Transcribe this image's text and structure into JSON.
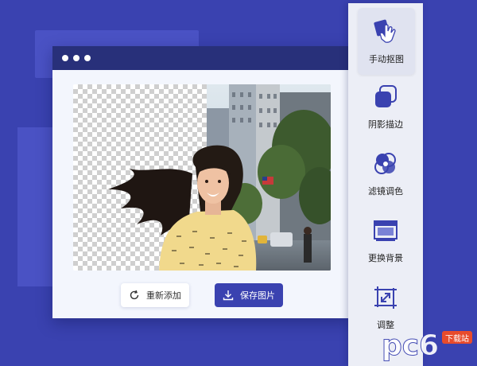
{
  "toolbar": {
    "readd_label": "重新添加",
    "save_label": "保存图片"
  },
  "tools": [
    {
      "label": "手动抠图",
      "icon": "hand-cutout-icon",
      "active": true
    },
    {
      "label": "阴影描边",
      "icon": "shadow-outline-icon",
      "active": false
    },
    {
      "label": "滤镜调色",
      "icon": "filter-color-icon",
      "active": false
    },
    {
      "label": "更换背景",
      "icon": "change-background-icon",
      "active": false
    },
    {
      "label": "调整",
      "icon": "resize-icon",
      "active": false
    }
  ],
  "watermark": {
    "logo": "pc6",
    "tag": "下载站"
  },
  "colors": {
    "background": "#3a42b0",
    "titlebar": "#28307a",
    "accent": "#3a42b0",
    "panel": "#eceef6"
  }
}
